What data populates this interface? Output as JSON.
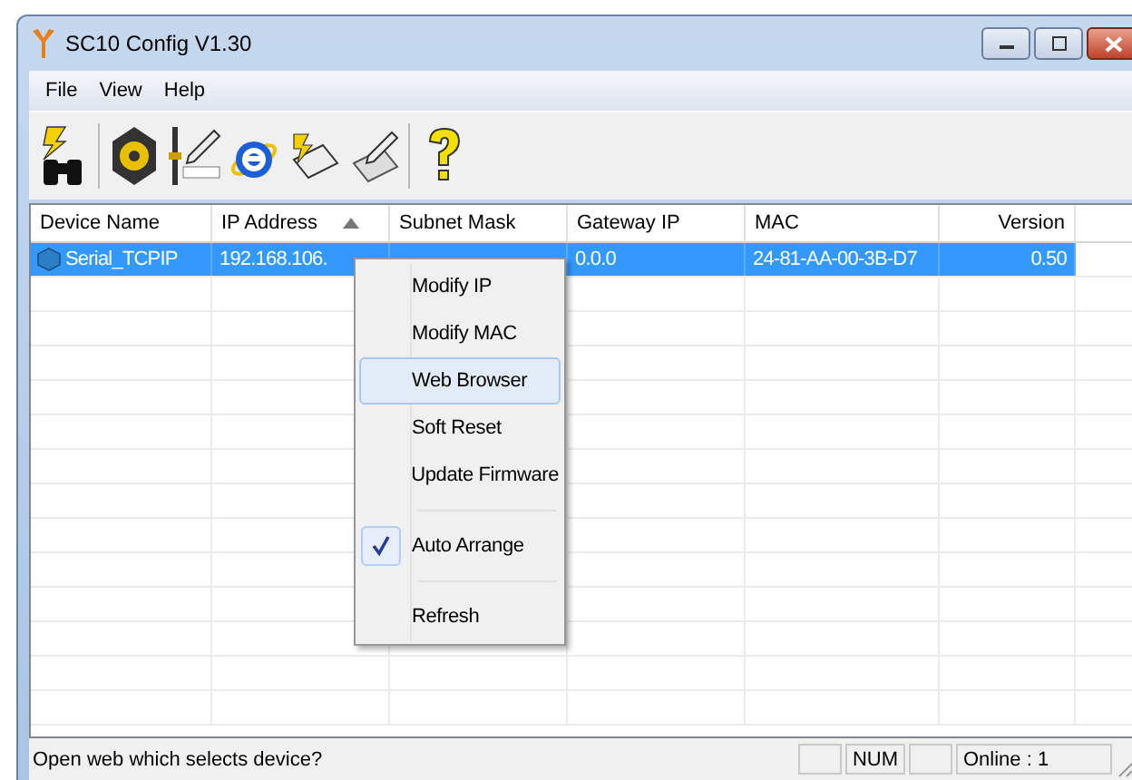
{
  "window": {
    "title": "SC10 Config V1.30"
  },
  "menu_bar": [
    "File",
    "View",
    "Help"
  ],
  "table": {
    "columns": [
      {
        "label": "Device Name",
        "sorted": false
      },
      {
        "label": "IP Address",
        "sorted": true
      },
      {
        "label": "Subnet Mask",
        "sorted": false
      },
      {
        "label": "Gateway IP",
        "sorted": false
      },
      {
        "label": "MAC",
        "sorted": false
      },
      {
        "label": "Version",
        "sorted": false
      }
    ],
    "rows": [
      {
        "selected": true,
        "cells": [
          "Serial_TCPIP",
          "192.168.106.",
          "",
          "0.0.0",
          "24-81-AA-00-3B-D7",
          "0.50"
        ]
      }
    ]
  },
  "context_menu": [
    {
      "kind": "item",
      "label": "Modify IP",
      "selected": false,
      "checked": false
    },
    {
      "kind": "item",
      "label": "Modify MAC",
      "selected": false,
      "checked": false
    },
    {
      "kind": "item",
      "label": "Web Browser",
      "selected": true,
      "checked": false
    },
    {
      "kind": "item",
      "label": "Soft Reset",
      "selected": false,
      "checked": false
    },
    {
      "kind": "item",
      "label": "Update Firmware",
      "selected": false,
      "checked": false
    },
    {
      "kind": "separator"
    },
    {
      "kind": "item",
      "label": "Auto Arrange",
      "selected": false,
      "checked": true
    },
    {
      "kind": "separator"
    },
    {
      "kind": "item",
      "label": "Refresh",
      "selected": false,
      "checked": false
    }
  ],
  "status_bar": {
    "message": "Open web which selects device?",
    "panes": [
      "NUM",
      "Online : 1"
    ]
  }
}
